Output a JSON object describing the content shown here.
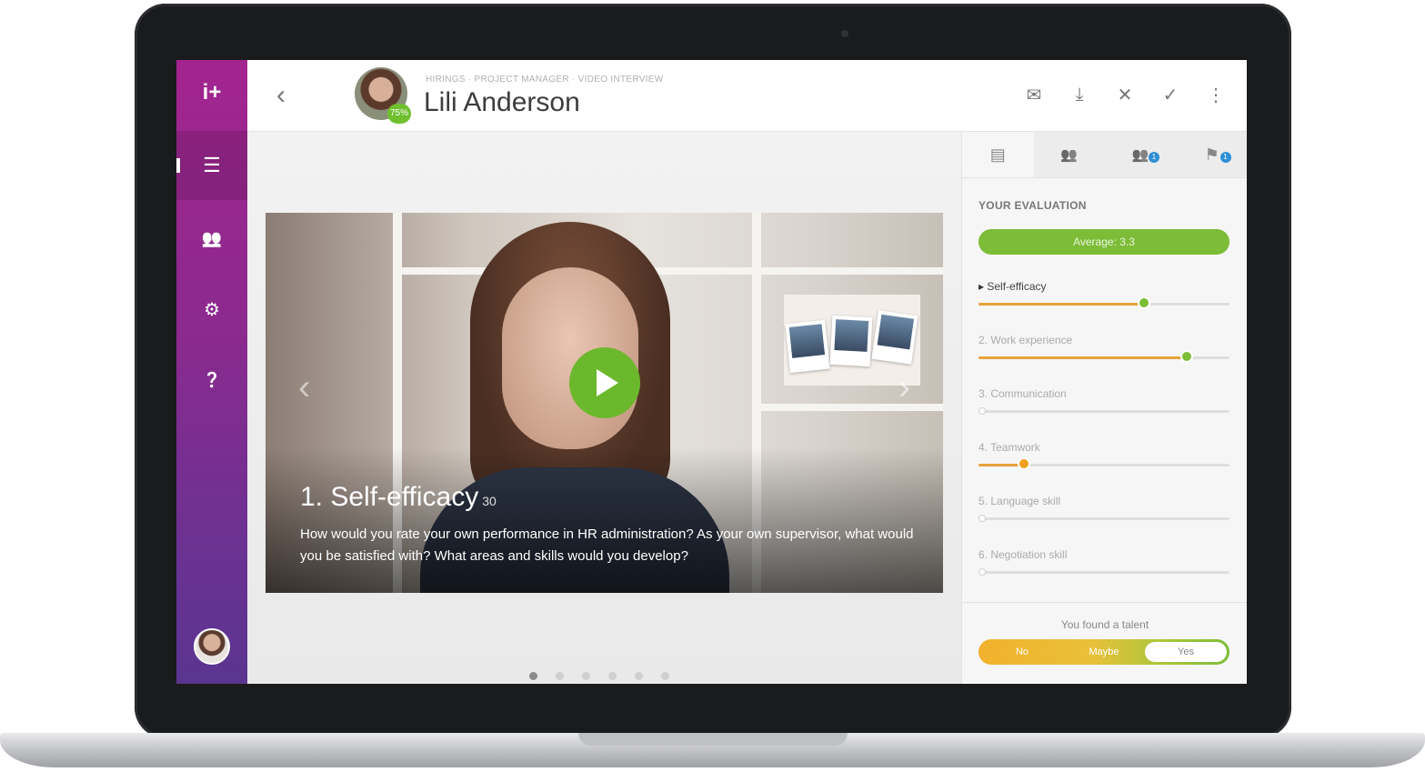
{
  "sidebar": {
    "logo": "i+",
    "items": [
      {
        "icon": "list-icon",
        "glyph": "☰",
        "active": true
      },
      {
        "icon": "people-icon",
        "glyph": "👥",
        "active": false
      },
      {
        "icon": "gear-icon",
        "glyph": "⚙",
        "active": false
      },
      {
        "icon": "help-icon",
        "glyph": "❓",
        "active": false
      }
    ]
  },
  "header": {
    "back_glyph": "‹",
    "breadcrumb": "HIRINGS · PROJECT MANAGER · VIDEO INTERVIEW",
    "candidate_name": "Lili Anderson",
    "score_badge": "75%",
    "actions": [
      {
        "icon": "mail-icon",
        "glyph": "✉"
      },
      {
        "icon": "download-icon",
        "glyph": "⤓"
      },
      {
        "icon": "close-icon",
        "glyph": "✕"
      },
      {
        "icon": "check-icon",
        "glyph": "✓"
      },
      {
        "icon": "more-vertical-icon",
        "glyph": "⋮"
      }
    ]
  },
  "video": {
    "question_title": "1. Self-efficacy",
    "question_duration": "30",
    "question_text": "How would you rate your own performance in HR administration? As your own supervisor, what would you be satisfied with? What areas and skills would you develop?",
    "prev_glyph": "‹",
    "next_glyph": "›",
    "dots_total": 6,
    "dots_active": 1
  },
  "panel": {
    "tabs": [
      {
        "icon": "evaluation-icon",
        "glyph": "▤",
        "badge": ""
      },
      {
        "icon": "team-icon",
        "glyph": "👥",
        "badge": ""
      },
      {
        "icon": "reviewers-icon",
        "glyph": "👥",
        "badge": "1"
      },
      {
        "icon": "comments-icon",
        "glyph": "⚑",
        "badge": "1"
      }
    ],
    "eval_title": "YOUR EVALUATION",
    "average_label": "Average: 3.3",
    "criteria": [
      {
        "label": "Self-efficacy",
        "value": 0.66,
        "color": "#e8a23a",
        "knob": "#7cbc36"
      },
      {
        "label": "2. Work experience",
        "value": 0.83,
        "color": "#e8a23a",
        "knob": "#7cbc36"
      },
      {
        "label": "3. Communication",
        "value": 0,
        "color": "#dedede",
        "knob": ""
      },
      {
        "label": "4. Teamwork",
        "value": 0.18,
        "color": "#e8a23a",
        "knob": "#f0a020"
      },
      {
        "label": "5. Language skill",
        "value": 0,
        "color": "#dedede",
        "knob": ""
      },
      {
        "label": "6. Negotiation skill",
        "value": 0,
        "color": "#dedede",
        "knob": ""
      }
    ],
    "talent_question": "You found a talent",
    "talent_options": [
      "No",
      "Maybe",
      "Yes"
    ],
    "talent_selected": "Yes"
  }
}
